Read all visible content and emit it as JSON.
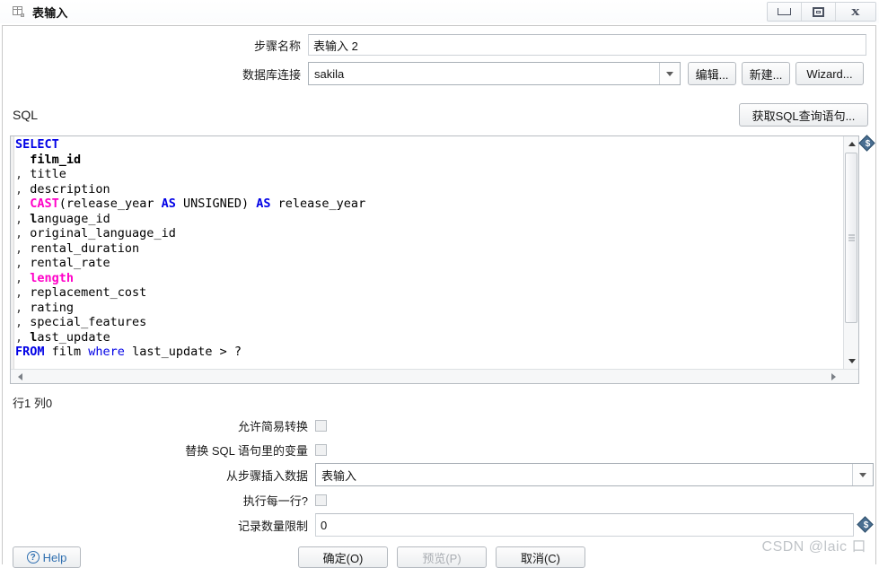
{
  "window": {
    "title": "表输入",
    "icon": "table-input-icon",
    "controls": {
      "minimize": "minimize-icon",
      "maximize": "maximize-icon",
      "close": "close-icon"
    }
  },
  "form_top": {
    "step_name_label": "步骤名称",
    "step_name_value": "表输入 2",
    "connection_label": "数据库连接",
    "connection_value": "sakila",
    "edit_button": "编辑...",
    "new_button": "新建...",
    "wizard_button": "Wizard..."
  },
  "sql_section": {
    "label": "SQL",
    "get_sql_button": "获取SQL查询语句...",
    "variable_icon": "variable-dollar-icon",
    "code_lines": [
      "SELECT",
      "  film_id",
      ", title",
      ", description",
      ", CAST(release_year AS UNSIGNED) AS release_year",
      ", language_id",
      ", original_language_id",
      ", rental_duration",
      ", rental_rate",
      ", length",
      ", replacement_cost",
      ", rating",
      ", special_features",
      ", last_update",
      "FROM film where last_update > ?"
    ],
    "caret_status": "行1 列0"
  },
  "form_bottom": {
    "lazy_conversion_label": "允许简易转换",
    "lazy_conversion_checked": false,
    "replace_variables_label": "替换 SQL 语句里的变量",
    "replace_variables_checked": false,
    "insert_from_step_label": "从步骤插入数据",
    "insert_from_step_value": "表输入",
    "execute_each_row_label": "执行每一行?",
    "execute_each_row_checked": false,
    "limit_label": "记录数量限制",
    "limit_value": "0",
    "limit_variable_icon": "variable-dollar-icon"
  },
  "footer": {
    "help_label": "Help",
    "help_icon": "question-circle-icon",
    "ok_label": "确定(O)",
    "preview_label": "预览(P)",
    "cancel_label": "取消(C)"
  },
  "watermark": "CSDN @laic 口",
  "colors": {
    "keyword": "#0000e6",
    "function": "#ff00c8",
    "accent": "#2f6fb0",
    "variable_badge": "#4a6f92"
  }
}
